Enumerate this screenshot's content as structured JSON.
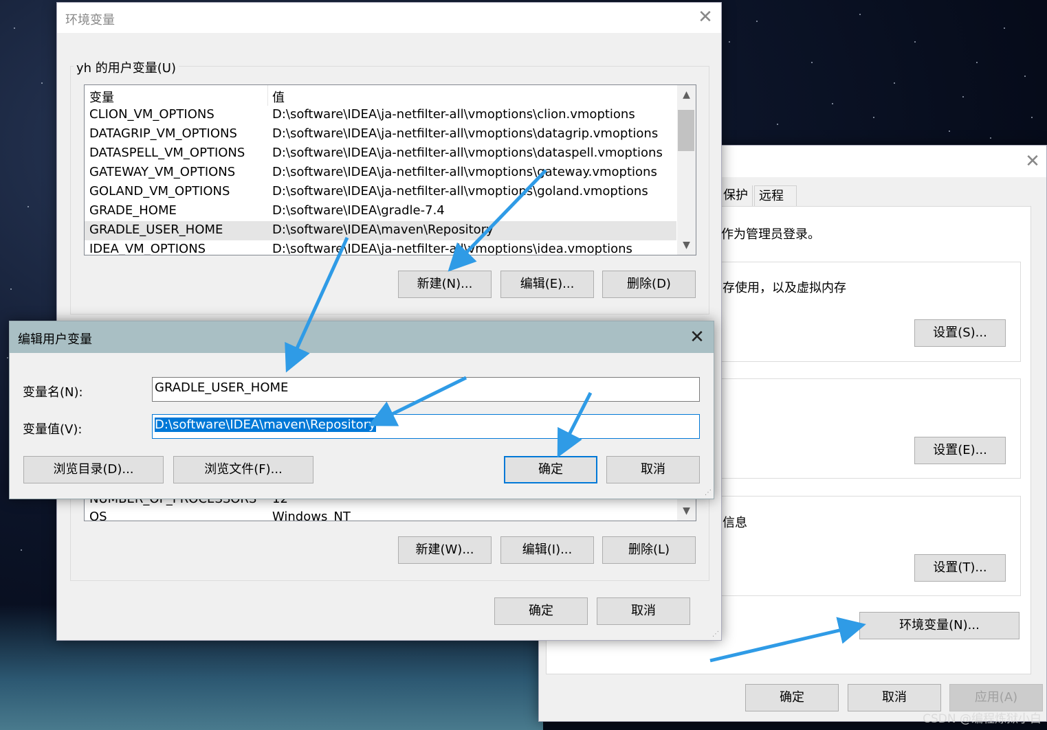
{
  "system_properties": {
    "tabs": [
      "保护",
      "远程"
    ],
    "admin_note": "作为管理员登录。",
    "performance_text": "存使用，以及虚拟内存",
    "startup_text": "信息",
    "settings_s": "设置(S)...",
    "settings_e": "设置(E)...",
    "settings_t": "设置(T)...",
    "env_vars_button": "环境变量(N)...",
    "ok": "确定",
    "cancel": "取消",
    "apply": "应用(A)"
  },
  "env_window": {
    "title": "环境变量",
    "user_group_label": "yh 的用户变量(U)",
    "columns": {
      "name": "变量",
      "value": "值"
    },
    "user_vars": [
      {
        "name": "CLION_VM_OPTIONS",
        "value": "D:\\software\\IDEA\\ja-netfilter-all\\vmoptions\\clion.vmoptions"
      },
      {
        "name": "DATAGRIP_VM_OPTIONS",
        "value": "D:\\software\\IDEA\\ja-netfilter-all\\vmoptions\\datagrip.vmoptions"
      },
      {
        "name": "DATASPELL_VM_OPTIONS",
        "value": "D:\\software\\IDEA\\ja-netfilter-all\\vmoptions\\dataspell.vmoptions"
      },
      {
        "name": "GATEWAY_VM_OPTIONS",
        "value": "D:\\software\\IDEA\\ja-netfilter-all\\vmoptions\\gateway.vmoptions"
      },
      {
        "name": "GOLAND_VM_OPTIONS",
        "value": "D:\\software\\IDEA\\ja-netfilter-all\\vmoptions\\goland.vmoptions"
      },
      {
        "name": "GRADE_HOME",
        "value": "D:\\software\\IDEA\\gradle-7.4"
      },
      {
        "name": "GRADLE_USER_HOME",
        "value": "D:\\software\\IDEA\\maven\\Repository"
      },
      {
        "name": "IDEA_VM_OPTIONS",
        "value": "D:\\software\\IDEA\\ja-netfilter-all\\vmoptions\\idea.vmoptions"
      }
    ],
    "user_buttons": {
      "new": "新建(N)...",
      "edit": "编辑(E)...",
      "delete": "删除(D)"
    },
    "system_vars": [
      {
        "name": "NUMBER_OF_PROCESSORS",
        "value": "12"
      },
      {
        "name": "OS",
        "value": "Windows_NT"
      }
    ],
    "system_buttons": {
      "new": "新建(W)...",
      "edit": "编辑(I)...",
      "delete": "删除(L)"
    },
    "ok": "确定",
    "cancel": "取消"
  },
  "edit_dialog": {
    "title": "编辑用户变量",
    "name_label": "变量名(N):",
    "value_label": "变量值(V):",
    "name_value": "GRADLE_USER_HOME",
    "value_value": "D:\\software\\IDEA\\maven\\Repository",
    "browse_dir": "浏览目录(D)...",
    "browse_file": "浏览文件(F)...",
    "ok": "确定",
    "cancel": "取消"
  },
  "watermark": "CSDN @编程炼狱小白",
  "colors": {
    "accent": "#0078d7",
    "arrow": "#2f9be6",
    "dialog_title": "#a9bfc4"
  }
}
